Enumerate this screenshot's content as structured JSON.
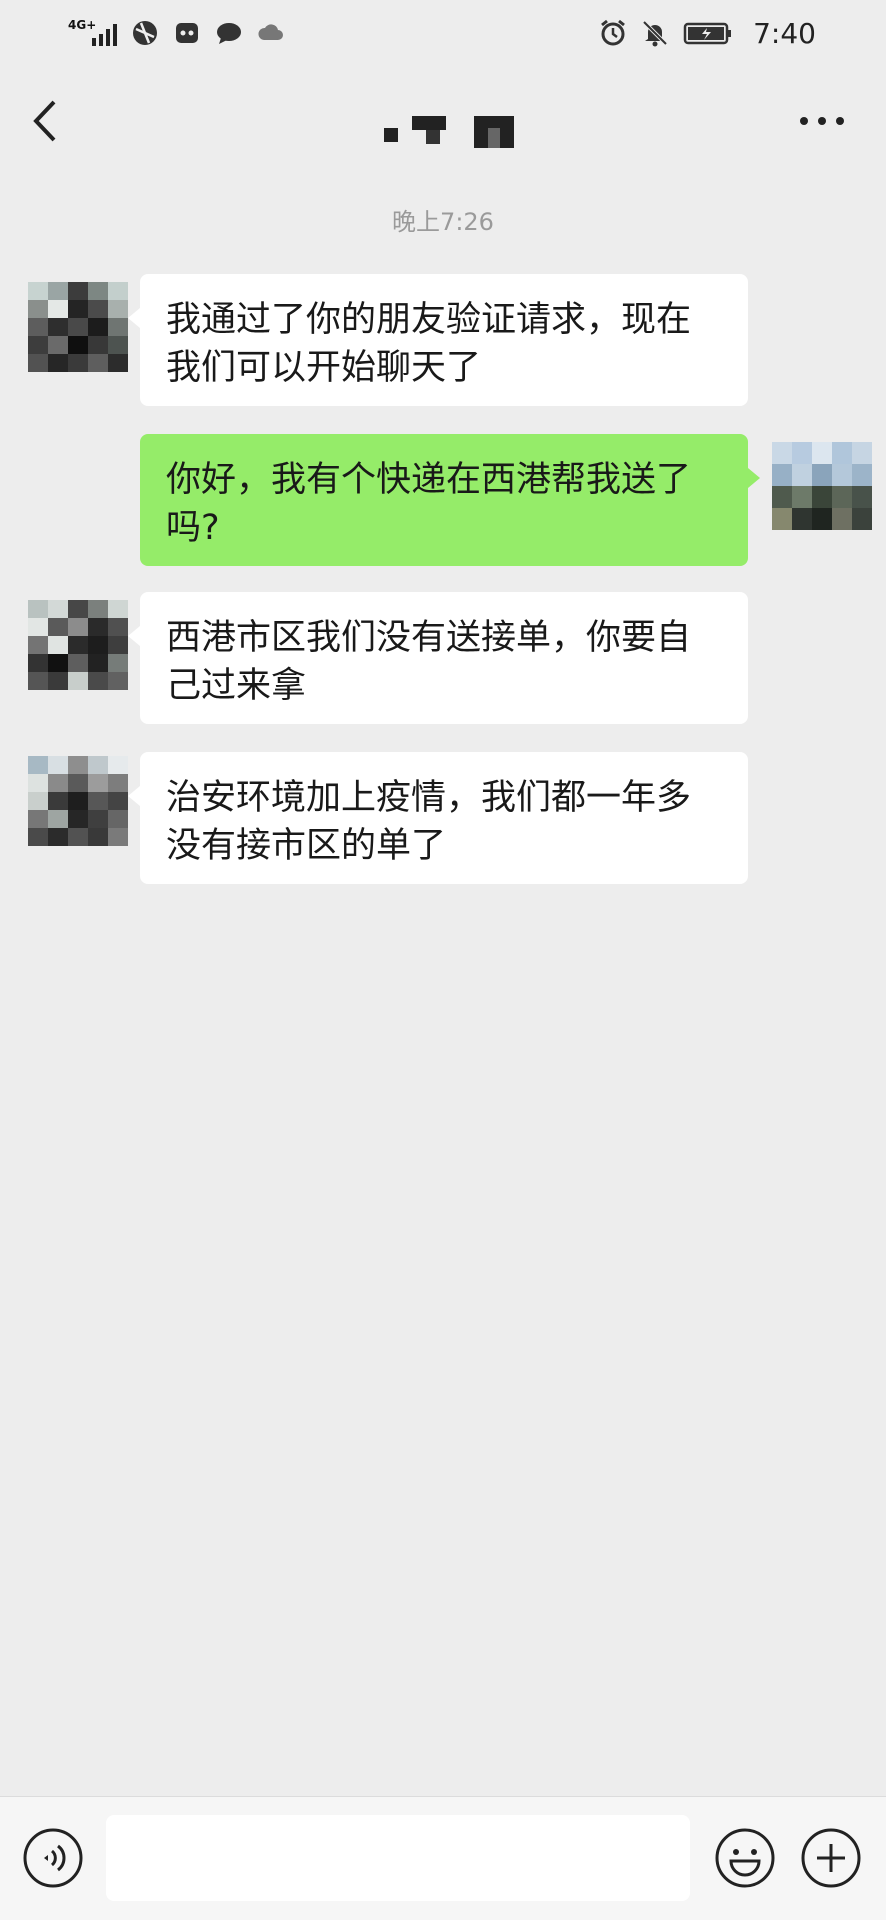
{
  "status_bar": {
    "network": "4G+",
    "time": "7:40"
  },
  "nav": {
    "title": ""
  },
  "chat": {
    "timestamp": "晚上7:26",
    "messages": [
      {
        "from": "other",
        "text": "我通过了你的朋友验证请求，现在我们可以开始聊天了"
      },
      {
        "from": "self",
        "text": "你好，我有个快递在西港帮我送了吗?"
      },
      {
        "from": "other",
        "text": "西港市区我们没有送接单，你要自己过来拿"
      },
      {
        "from": "other",
        "text": "治安环境加上疫情，我们都一年多没有接市区的单了"
      }
    ]
  },
  "input_bar": {
    "message_value": ""
  },
  "colors": {
    "background": "#ededed",
    "self_bubble": "#95ec69",
    "other_bubble": "#ffffff",
    "timestamp": "#9a9a9a"
  },
  "icons": [
    "back-arrow-icon",
    "more-icon",
    "voice-icon",
    "emoji-icon",
    "add-icon",
    "alarm-icon",
    "mute-icon",
    "battery-icon"
  ]
}
